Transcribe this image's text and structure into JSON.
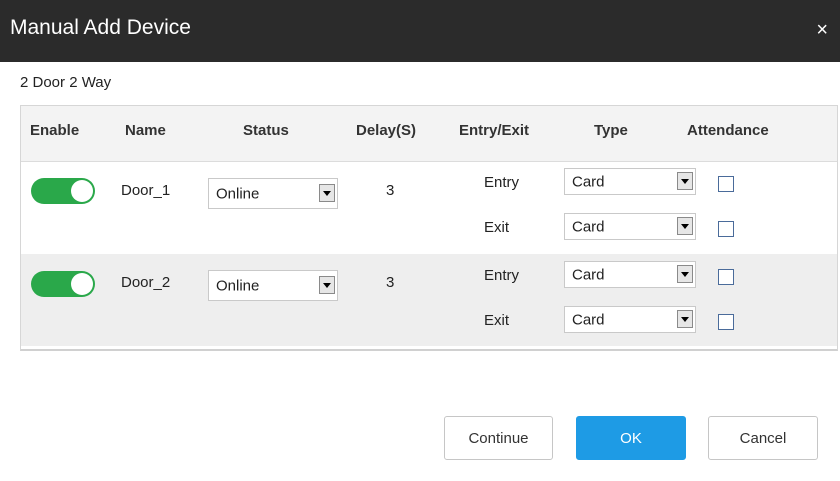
{
  "dialog": {
    "title": "Manual Add Device",
    "close_glyph": "×",
    "subtitle": "2 Door 2 Way"
  },
  "table": {
    "headers": [
      "Enable",
      "Name",
      "Status",
      "Delay(S)",
      "Entry/Exit",
      "Type",
      "Attendance"
    ],
    "doors": [
      {
        "enabled": true,
        "name": "Door_1",
        "status": "Online",
        "delay": "3",
        "ways": [
          {
            "direction": "Entry",
            "type": "Card",
            "attendance": false
          },
          {
            "direction": "Exit",
            "type": "Card",
            "attendance": false
          }
        ]
      },
      {
        "enabled": true,
        "name": "Door_2",
        "status": "Online",
        "delay": "3",
        "ways": [
          {
            "direction": "Entry",
            "type": "Card",
            "attendance": false
          },
          {
            "direction": "Exit",
            "type": "Card",
            "attendance": false
          }
        ]
      }
    ]
  },
  "buttons": {
    "continue": "Continue",
    "ok": "OK",
    "cancel": "Cancel"
  },
  "colors": {
    "titlebar": "#2b2b2b",
    "toggle_on": "#2aa84a",
    "primary": "#1e9be5"
  }
}
